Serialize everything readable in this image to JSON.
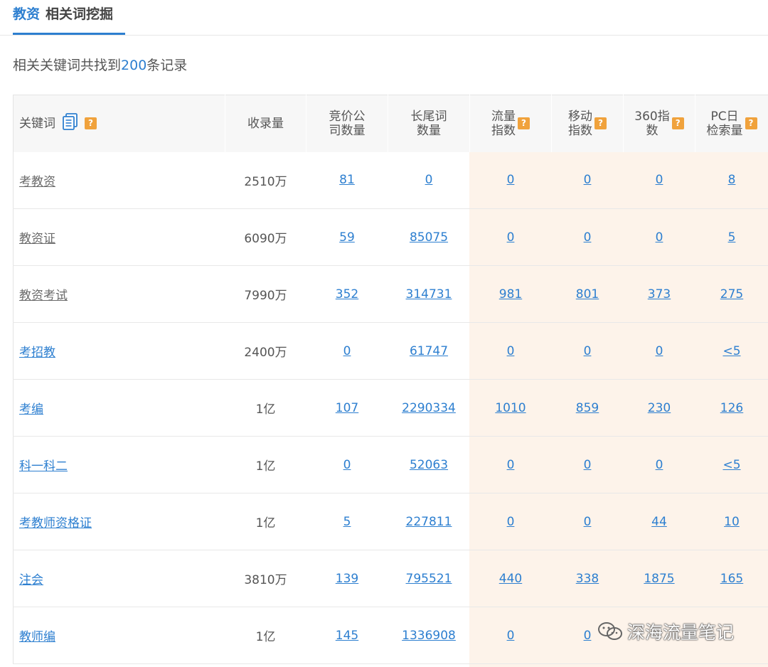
{
  "tab": {
    "keyword": "教资",
    "label": "相关词挖掘"
  },
  "summary": {
    "prefix": "相关关键词共找到",
    "count": "200",
    "suffix": "条记录"
  },
  "headers": [
    "关键词",
    "收录量",
    "竞价公\n司数量",
    "长尾词\n数量",
    "流量\n指数",
    "移动\n指数",
    "360指\n数",
    "PC日\n检索量"
  ],
  "help_icon_text": "?",
  "rows": [
    {
      "keyword": "考教资",
      "linked": false,
      "included": "2510万",
      "bid": "81",
      "longtail": "0",
      "traffic": "0",
      "mobile": "0",
      "idx360": "0",
      "pc": "8"
    },
    {
      "keyword": "教资证",
      "linked": false,
      "included": "6090万",
      "bid": "59",
      "longtail": "85075",
      "traffic": "0",
      "mobile": "0",
      "idx360": "0",
      "pc": "5"
    },
    {
      "keyword": "教资考试",
      "linked": false,
      "included": "7990万",
      "bid": "352",
      "longtail": "314731",
      "traffic": "981",
      "mobile": "801",
      "idx360": "373",
      "pc": "275"
    },
    {
      "keyword": "考招教",
      "linked": true,
      "included": "2400万",
      "bid": "0",
      "longtail": "61747",
      "traffic": "0",
      "mobile": "0",
      "idx360": "0",
      "pc": "<5"
    },
    {
      "keyword": "考编",
      "linked": true,
      "included": "1亿",
      "bid": "107",
      "longtail": "2290334",
      "traffic": "1010",
      "mobile": "859",
      "idx360": "230",
      "pc": "126"
    },
    {
      "keyword": "科一科二",
      "linked": true,
      "included": "1亿",
      "bid": "0",
      "longtail": "52063",
      "traffic": "0",
      "mobile": "0",
      "idx360": "0",
      "pc": "<5"
    },
    {
      "keyword": "考教师资格证",
      "linked": true,
      "included": "1亿",
      "bid": "5",
      "longtail": "227811",
      "traffic": "0",
      "mobile": "0",
      "idx360": "44",
      "pc": "10"
    },
    {
      "keyword": "注会",
      "linked": true,
      "included": "3810万",
      "bid": "139",
      "longtail": "795521",
      "traffic": "440",
      "mobile": "338",
      "idx360": "1875",
      "pc": "165"
    },
    {
      "keyword": "教师编",
      "linked": true,
      "included": "1亿",
      "bid": "145",
      "longtail": "1336908",
      "traffic": "0",
      "mobile": "0",
      "idx360": "",
      "pc": ""
    }
  ],
  "watermark": "深海流量笔记",
  "colors": {
    "accent": "#2d7fd0",
    "help_badge": "#f0a23c",
    "highlight_bg": "#fdf3ea"
  }
}
